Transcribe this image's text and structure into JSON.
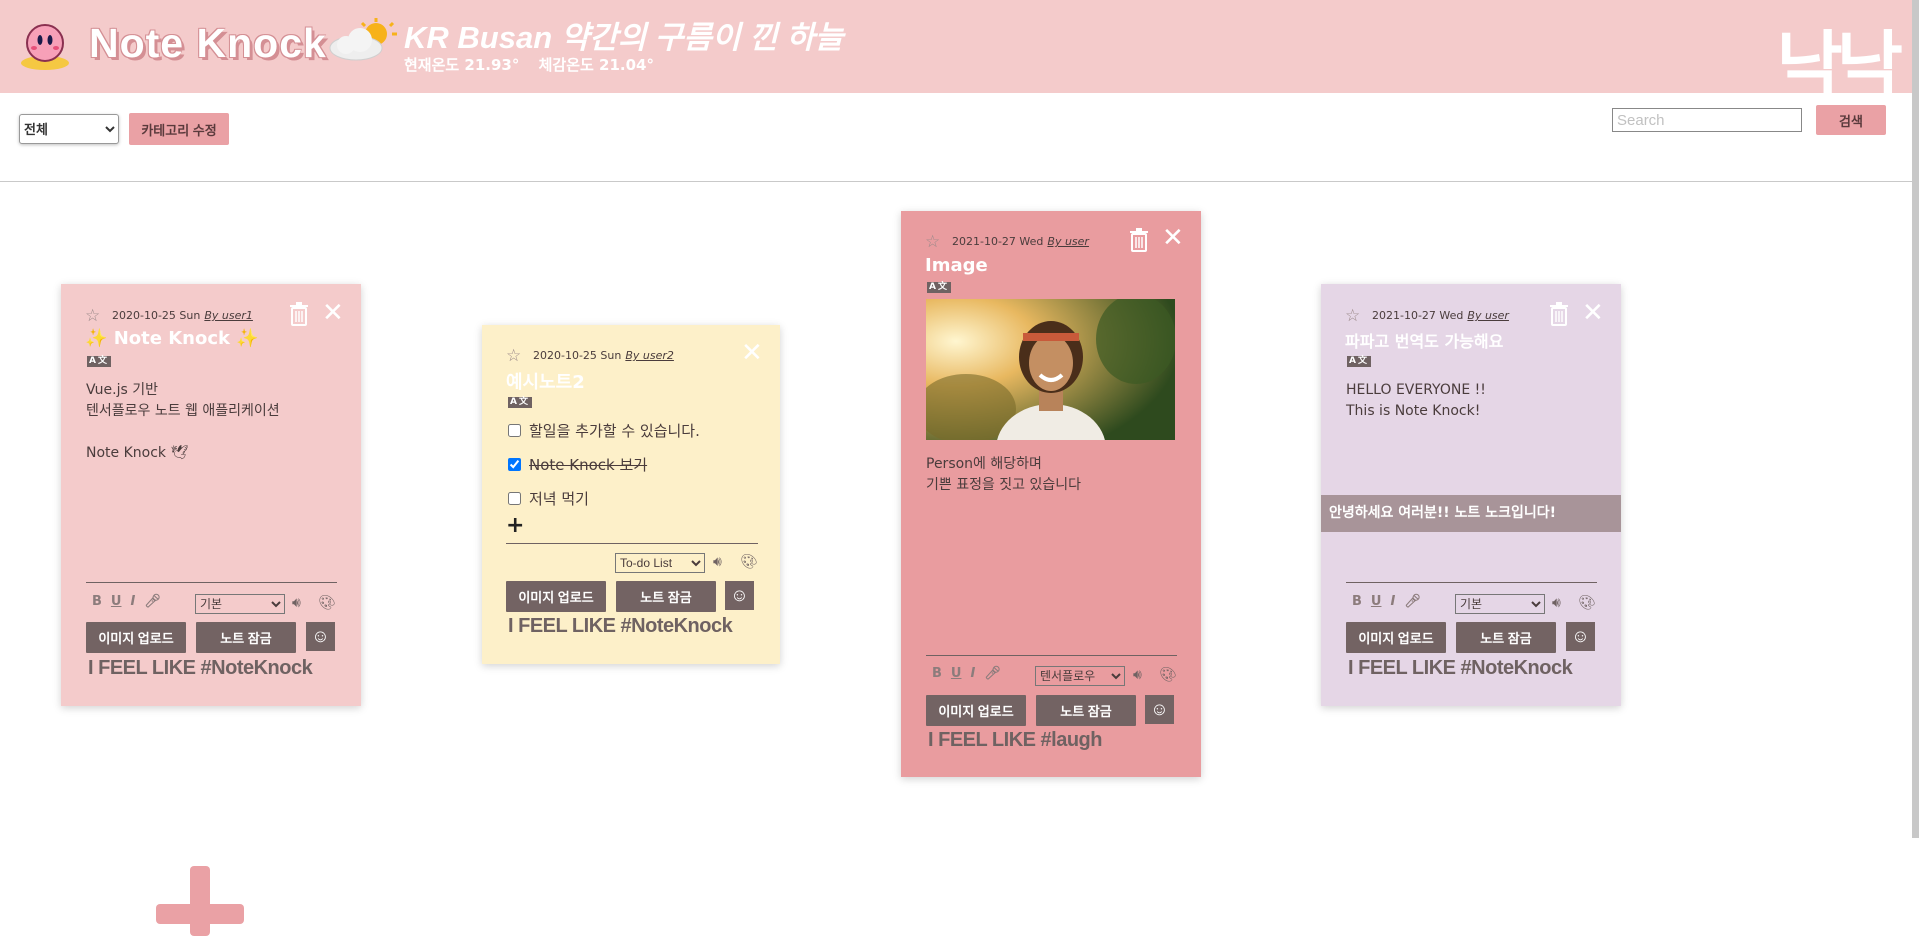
{
  "header": {
    "app_title": "Note Knock",
    "weather_title": "KR Busan 약간의 구름이 낀 하늘",
    "current_temp": "현재온도 21.93°",
    "feels_like": "체감온도 21.04°",
    "logo_text": "낙낙"
  },
  "toolbar": {
    "category_selected": "전체",
    "category_edit_label": "카테고리 수정",
    "search_placeholder": "Search",
    "search_button_label": "검색"
  },
  "colors": {
    "header_bg": "#f4cbcb",
    "note_pink": "#f4cbcb",
    "note_yellow": "#fdf0c9",
    "note_rose": "#e99c9f",
    "note_lavender": "#e5d6e6",
    "button_dark": "#736363",
    "button_pink": "#eaa1a5"
  },
  "notes": [
    {
      "date": "2020-10-25 Sun",
      "author": "By user1",
      "title": "Note Knock",
      "translate_badge": "A文",
      "body_lines": [
        "Vue.js 기반",
        "텐서플로우 노트 웹 애플리케이션",
        "",
        "Note Knock 🕊"
      ],
      "format": {
        "bold": "B",
        "underline": "U",
        "italic": "I"
      },
      "voice": "기본",
      "upload_label": "이미지 업로드",
      "lock_label": "노트 잠금",
      "feel": "I FEEL LIKE #NoteKnock"
    },
    {
      "date": "2020-10-25 Sun",
      "author": "By user2",
      "title": "예시노트2",
      "translate_badge": "A文",
      "todos": [
        {
          "text": "할일을 추가할 수 있습니다.",
          "done": false
        },
        {
          "text": "Note Knock 보기",
          "done": true
        },
        {
          "text": "저녁 먹기",
          "done": false
        }
      ],
      "add_label": "+",
      "type": "To-do List",
      "upload_label": "이미지 업로드",
      "lock_label": "노트 잠금",
      "feel": "I FEEL LIKE #NoteKnock"
    },
    {
      "date": "2021-10-27 Wed",
      "author": "By user",
      "title": "Image",
      "translate_badge": "A文",
      "body_lines": [
        "Person에 해당하며",
        "기쁜 표정을 짓고 있습니다"
      ],
      "format": {
        "bold": "B",
        "underline": "U",
        "italic": "I"
      },
      "voice": "텐서플로우",
      "upload_label": "이미지 업로드",
      "lock_label": "노트 잠금",
      "feel": "I FEEL LIKE #laugh"
    },
    {
      "date": "2021-10-27 Wed",
      "author": "By user",
      "title": "파파고 번역도 가능해요",
      "translate_badge": "A文",
      "body_lines": [
        "HELLO EVERYONE !!",
        "This is Note Knock!"
      ],
      "translation": "안녕하세요 여러분!! 노트 노크입니다!",
      "format": {
        "bold": "B",
        "underline": "U",
        "italic": "I"
      },
      "voice": "기본",
      "upload_label": "이미지 업로드",
      "lock_label": "노트 잠금",
      "feel": "I FEEL LIKE #NoteKnock"
    }
  ],
  "add_note_label": "+"
}
